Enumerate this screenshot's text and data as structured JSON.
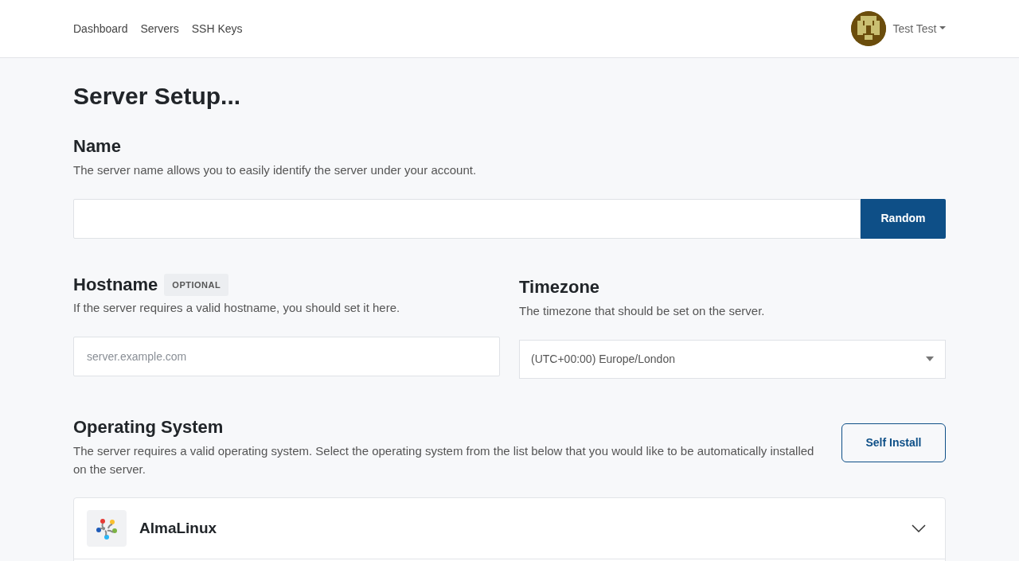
{
  "nav": {
    "links": [
      "Dashboard",
      "Servers",
      "SSH Keys"
    ],
    "user": "Test Test"
  },
  "title": "Server Setup...",
  "name_section": {
    "heading": "Name",
    "description": "The server name allows you to easily identify the server under your account.",
    "button": "Random"
  },
  "hostname_section": {
    "heading": "Hostname",
    "badge": "OPTIONAL",
    "description": "If the server requires a valid hostname, you should set it here.",
    "placeholder": "server.example.com"
  },
  "timezone_section": {
    "heading": "Timezone",
    "description": "The timezone that should be set on the server.",
    "value": "(UTC+00:00) Europe/London"
  },
  "os_section": {
    "heading": "Operating System",
    "description": "The server requires a valid operating system. Select the operating system from the list below that you would like to be automatically installed on the server.",
    "button": "Self Install",
    "options": [
      {
        "name": "AlmaLinux"
      }
    ]
  }
}
